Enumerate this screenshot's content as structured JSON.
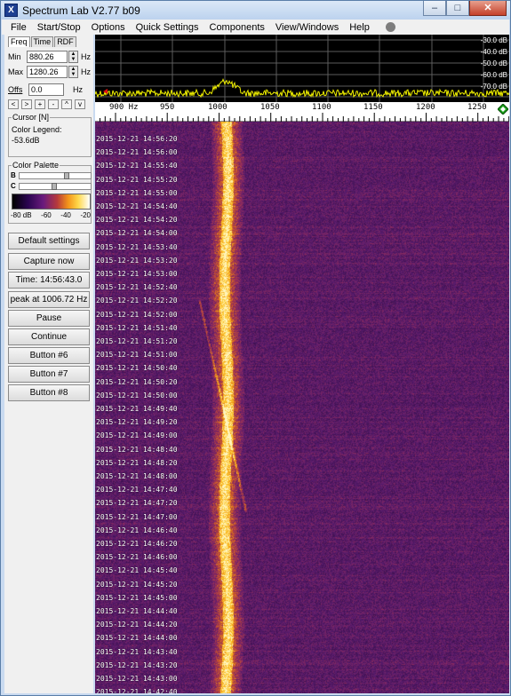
{
  "window": {
    "title": "Spectrum Lab V2.77 b09",
    "app_icon_glyph": "X",
    "controls": {
      "minimize": "–",
      "maximize": "□",
      "close": "✕"
    }
  },
  "menu": [
    {
      "label": "File"
    },
    {
      "label": "Start/Stop"
    },
    {
      "label": "Options"
    },
    {
      "label": "Quick Settings"
    },
    {
      "label": "Components"
    },
    {
      "label": "View/Windows"
    },
    {
      "label": "Help"
    }
  ],
  "left_panel": {
    "tabs": [
      "Freq",
      "Time",
      "RDF"
    ],
    "min": {
      "label": "Min",
      "value": "880.26",
      "unit": "Hz"
    },
    "max": {
      "label": "Max",
      "value": "1280.26",
      "unit": "Hz"
    },
    "offs": {
      "label": "Offs",
      "value": "0.0",
      "unit": "Hz"
    },
    "nav_buttons": [
      "<",
      ">",
      "+",
      "-",
      "^",
      "v"
    ],
    "cursor": {
      "title": "Cursor [N]",
      "legend_label": "Color Legend:",
      "value": "-53.6dB"
    },
    "palette": {
      "title": "Color Palette",
      "b_label": "B",
      "c_label": "C",
      "labels": [
        "-80 dB",
        "-60",
        "-40",
        "-20"
      ]
    },
    "buttons": {
      "default_settings": "Default settings",
      "capture_now": "Capture now",
      "time": "Time:  14:56:43.0",
      "peak": "peak at 1006.72 Hz",
      "pause": "Pause",
      "continue": "Continue",
      "button6": "Button #6",
      "button7": "Button #7",
      "button8": "Button #8"
    }
  },
  "spectrum": {
    "db_labels": [
      "-30.0 dB",
      "-40.0 dB",
      "-50.0 dB",
      "-60.0 dB",
      "-70.0 dB"
    ],
    "freq_labels": [
      "900 Hz",
      "950",
      "1000",
      "1050",
      "1100",
      "1150",
      "1200",
      "1250"
    ],
    "peak_freq_hz": 1006.72
  },
  "waterfall": {
    "timestamps": [
      "2015-12-21 14:56:20",
      "2015-12-21 14:56:00",
      "2015-12-21 14:55:40",
      "2015-12-21 14:55:20",
      "2015-12-21 14:55:00",
      "2015-12-21 14:54:40",
      "2015-12-21 14:54:20",
      "2015-12-21 14:54:00",
      "2015-12-21 14:53:40",
      "2015-12-21 14:53:20",
      "2015-12-21 14:53:00",
      "2015-12-21 14:52:40",
      "2015-12-21 14:52:20",
      "2015-12-21 14:52:00",
      "2015-12-21 14:51:40",
      "2015-12-21 14:51:20",
      "2015-12-21 14:51:00",
      "2015-12-21 14:50:40",
      "2015-12-21 14:50:20",
      "2015-12-21 14:50:00",
      "2015-12-21 14:49:40",
      "2015-12-21 14:49:20",
      "2015-12-21 14:49:00",
      "2015-12-21 14:48:40",
      "2015-12-21 14:48:20",
      "2015-12-21 14:48:00",
      "2015-12-21 14:47:40",
      "2015-12-21 14:47:20",
      "2015-12-21 14:47:00",
      "2015-12-21 14:46:40",
      "2015-12-21 14:46:20",
      "2015-12-21 14:46:00",
      "2015-12-21 14:45:40",
      "2015-12-21 14:45:20",
      "2015-12-21 14:45:00",
      "2015-12-21 14:44:40",
      "2015-12-21 14:44:20",
      "2015-12-21 14:44:00",
      "2015-12-21 14:43:40",
      "2015-12-21 14:43:20",
      "2015-12-21 14:43:00",
      "2015-12-21 14:42:40"
    ]
  },
  "colors": {
    "waterfall_bg": "#5a1c6b",
    "signal": "#ffb21c",
    "spectrum_trace": "#f0f000"
  }
}
